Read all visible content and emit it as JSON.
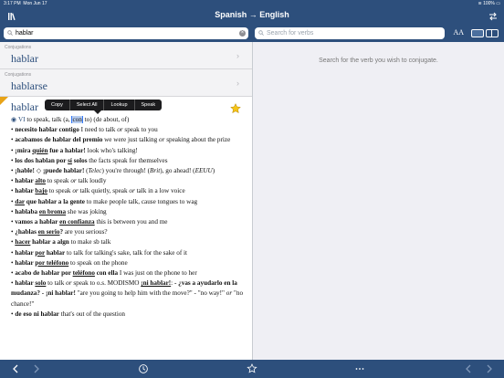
{
  "status": {
    "time": "3:17 PM",
    "date": "Mon Jun 17",
    "battery": "100%"
  },
  "nav": {
    "title": "Spanish → English"
  },
  "search": {
    "value": "hablar",
    "verbs_placeholder": "Search for verbs",
    "text_size_label": "AA"
  },
  "conjugations": [
    {
      "label": "Conjugations",
      "word": "hablar"
    },
    {
      "label": "Conjugations",
      "word": "hablarse"
    }
  ],
  "context_menu": [
    "Copy",
    "Select All",
    "Lookup",
    "Speak"
  ],
  "entry": {
    "headword": "hablar",
    "pos": "VI",
    "def_pre": " to speak, talk (a, ",
    "def_sel": "con",
    "def_post": " to) (de about, of)"
  },
  "examples": [
    [
      {
        "t": "• "
      },
      {
        "t": "necesito hablar contigo",
        "b": true
      },
      {
        "t": " I need to talk "
      },
      {
        "t": "or",
        "i": true
      },
      {
        "t": " speak to you"
      }
    ],
    [
      {
        "t": "• "
      },
      {
        "t": "acabamos de hablar del premio",
        "b": true
      },
      {
        "t": " we were just talking "
      },
      {
        "t": "or",
        "i": true
      },
      {
        "t": " speaking about the prize"
      }
    ],
    [
      {
        "t": "• "
      },
      {
        "t": "¡mira ",
        "b": true
      },
      {
        "t": "quién",
        "u": true
      },
      {
        "t": " fue a hablar!",
        "b": true
      },
      {
        "t": " look who's talking!"
      }
    ],
    [
      {
        "t": "• "
      },
      {
        "t": "los dos hablan por ",
        "b": true
      },
      {
        "t": "sí",
        "u": true
      },
      {
        "t": " solos",
        "b": true
      },
      {
        "t": " the facts speak for themselves"
      }
    ],
    [
      {
        "t": "• "
      },
      {
        "t": "¡hable!",
        "b": true
      },
      {
        "t": " ◇ "
      },
      {
        "t": "¡puede hablar!",
        "b": true
      },
      {
        "t": " ("
      },
      {
        "t": "Telec",
        "i": true
      },
      {
        "t": ") you're through! ("
      },
      {
        "t": "Brit",
        "i": true
      },
      {
        "t": "), go ahead! ("
      },
      {
        "t": "EEUU",
        "i": true
      },
      {
        "t": ")"
      }
    ],
    [
      {
        "t": "• "
      },
      {
        "t": "hablar ",
        "b": true
      },
      {
        "t": "alto",
        "u": true
      },
      {
        "t": " to speak "
      },
      {
        "t": "or",
        "i": true
      },
      {
        "t": " talk loudly"
      }
    ],
    [
      {
        "t": "• "
      },
      {
        "t": "hablar ",
        "b": true
      },
      {
        "t": "bajo",
        "u": true
      },
      {
        "t": " to speak "
      },
      {
        "t": "or",
        "i": true
      },
      {
        "t": " talk quietly, speak "
      },
      {
        "t": "or",
        "i": true
      },
      {
        "t": " talk in a low voice"
      }
    ],
    [
      {
        "t": "• "
      },
      {
        "t": "dar",
        "u": true
      },
      {
        "t": " que hablar a la gente",
        "b": true
      },
      {
        "t": " to make people talk, cause tongues to wag"
      }
    ],
    [
      {
        "t": "• "
      },
      {
        "t": "hablaba ",
        "b": true
      },
      {
        "t": "en broma",
        "u": true
      },
      {
        "t": " she was joking"
      }
    ],
    [
      {
        "t": "• "
      },
      {
        "t": "vamos a hablar ",
        "b": true
      },
      {
        "t": "en confianza",
        "u": true
      },
      {
        "t": " this is between you and me"
      }
    ],
    [
      {
        "t": "• "
      },
      {
        "t": "¿hablas ",
        "b": true
      },
      {
        "t": "en serio",
        "u": true
      },
      {
        "t": "?",
        "b": true
      },
      {
        "t": " are you serious?"
      }
    ],
    [
      {
        "t": "• "
      },
      {
        "t": "hacer",
        "u": true
      },
      {
        "t": " hablar a algn",
        "b": true
      },
      {
        "t": " to make sb talk"
      }
    ],
    [
      {
        "t": "• "
      },
      {
        "t": "hablar ",
        "b": true
      },
      {
        "t": "por",
        "u": true
      },
      {
        "t": " hablar",
        "b": true
      },
      {
        "t": " to talk for talking's sake, talk for the sake of it"
      }
    ],
    [
      {
        "t": "• "
      },
      {
        "t": "hablar ",
        "b": true
      },
      {
        "t": "por teléfono",
        "u": true
      },
      {
        "t": " to speak on the phone"
      }
    ],
    [
      {
        "t": "• "
      },
      {
        "t": "acabo de hablar por ",
        "b": true
      },
      {
        "t": "teléfono",
        "u": true
      },
      {
        "t": " con ella",
        "b": true
      },
      {
        "t": " I was just on the phone to her"
      }
    ],
    [
      {
        "t": "• "
      },
      {
        "t": "hablar ",
        "b": true
      },
      {
        "t": "solo",
        "u": true
      },
      {
        "t": " to talk "
      },
      {
        "t": "or",
        "i": true
      },
      {
        "t": " speak to o.s. MODISMO "
      },
      {
        "t": "¡ni hablar!",
        "u": true
      },
      {
        "t": ": "
      },
      {
        "t": "- ¿vas a ayudarlo en la mudanza? - ¡ni hablar!",
        "b": true
      },
      {
        "t": " \"are you going to help him with the move?\" - \"no way!\" "
      },
      {
        "t": "or",
        "i": true
      },
      {
        "t": " \"no chance!\""
      }
    ],
    [
      {
        "t": "• "
      },
      {
        "t": "de eso ni hablar",
        "b": true
      },
      {
        "t": " that's out of the question"
      }
    ]
  ],
  "right": {
    "hint": "Search for the verb you wish to conjugate."
  },
  "colors": {
    "brand": "#2d4f7c",
    "accent": "#3478f6",
    "star": "#f5c518"
  }
}
